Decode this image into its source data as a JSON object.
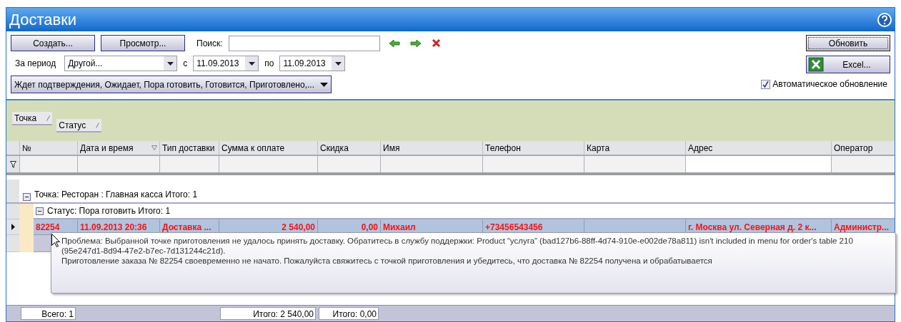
{
  "window": {
    "title": "Доставки"
  },
  "toolbar": {
    "create_button": "Создать...",
    "view_button": "Просмотр...",
    "search_label": "Поиск:",
    "period_label": "За период",
    "period_value": "Другой...",
    "from_label": "с",
    "from_date": "11.09.2013",
    "to_label": "по",
    "to_date": "11.09.2013",
    "status_filter": "Ждет подтверждения, Ожидает, Пора готовить, Готовится, Приготовлено,...",
    "refresh_button": "Обновить",
    "excel_button": "Excel...",
    "auto_refresh": {
      "label": "Автоматическое обновление",
      "checked": true
    }
  },
  "group_panel": [
    {
      "label": "Точка"
    },
    {
      "label": "Статус"
    }
  ],
  "table": {
    "columns": [
      {
        "label": "№",
        "kind": "text",
        "sorted": false,
        "total": "Всего: 1"
      },
      {
        "label": "Дата и время",
        "kind": "text",
        "sorted": true
      },
      {
        "label": "Тип доставки",
        "kind": "text",
        "sorted": false
      },
      {
        "label": "Сумма к оплате",
        "kind": "money",
        "sorted": false,
        "total": "Итого: 2 540,00"
      },
      {
        "label": "Скидка",
        "kind": "money",
        "sorted": false,
        "total": "Итого: 0,00"
      },
      {
        "label": "Имя",
        "kind": "text",
        "sorted": false
      },
      {
        "label": "Телефон",
        "kind": "text",
        "sorted": false
      },
      {
        "label": "Карта",
        "kind": "text",
        "sorted": false
      },
      {
        "label": "Адрес",
        "kind": "text",
        "sorted": false
      },
      {
        "label": "Оператор",
        "kind": "text",
        "sorted": false
      }
    ],
    "groups": [
      {
        "label": "Точка: Ресторан : Главная касса Итого: 1",
        "expanded": true,
        "children": [
          {
            "label": "Статус: Пора готовить Итого: 1",
            "expanded": true,
            "rows": [
              {
                "selected": true,
                "alert": true,
                "cells": [
                  "82254",
                  "11.09.2013 20:36",
                  "Доставка ...",
                  "2 540,00",
                  "0,00",
                  "Михаил",
                  "+73456543456",
                  "",
                  "г. Москва ул. Северная д. 2 к...",
                  "Администр..."
                ]
              }
            ]
          }
        ]
      }
    ]
  },
  "tooltip": {
    "lines": [
      "Проблема: Выбранной точке приготовления не удалось принять доставку. Обратитесь в службу поддержки: Product “услуга” (bad127b6-88ff-4d74-910e-e002de78a811) isn't included in menu for order's table 210 (95e247d1-8d94-47e2-b7ec-7d131244c21d).",
      "Приготовление заказа № 82254 своевременно не начато. Пожалуйста свяжитесь с точкой приготовления и убедитесь, что доставка № 82254 получена и обрабатывается"
    ]
  }
}
